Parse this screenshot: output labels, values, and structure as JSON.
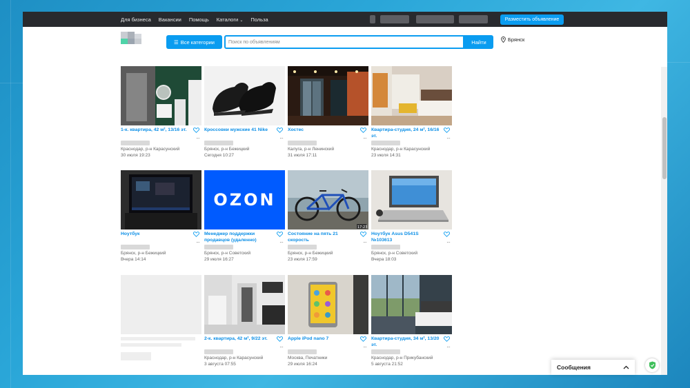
{
  "topbar": {
    "nav": [
      "Для бизнеса",
      "Вакансии",
      "Помощь",
      "Каталоги",
      "Польза"
    ],
    "post_button": "Разместить объявление"
  },
  "search": {
    "categories_button": "Все категории",
    "placeholder": "Поиск по объявлениям",
    "find_button": "Найти",
    "location": "Брянск"
  },
  "listings": [
    {
      "title": "1-к. квартира, 42 м², 13/16 эт.",
      "location": "Краснодар, р-н Карасунский",
      "date": "30 июля 19:23"
    },
    {
      "title": "Кроссовки мужские 41 Nike",
      "location": "Брянск, р-н Бежицкий",
      "date": "Сегодня 10:27"
    },
    {
      "title": "Хостес",
      "location": "Калуга, р-н Ленинский",
      "date": "31 июля 17:11"
    },
    {
      "title": "Квартира-студия, 24 м², 16/16 эт.",
      "location": "Краснодар, р-н Карасунский",
      "date": "23 июля 14:31"
    },
    {
      "title": "Ноутбук",
      "location": "Брянск, р-н Бежицкий",
      "date": "Вчера 14:14"
    },
    {
      "title": "Менеджер поддержки продавцов (удаленно)",
      "location": "Брянск, р-н Советский",
      "date": "29 июля 16:27"
    },
    {
      "title": "Состояние на пять 21 скорость",
      "location": "Брянск, р-н Бежицкий",
      "date": "23 июля 17:59"
    },
    {
      "title": "Ноутбук Asus D541S №103613",
      "location": "Брянск, р-н Советский",
      "date": "Вчера 18:03"
    },
    {
      "title": "2-к. квартира, 42 м², 9/22 эт.",
      "location": "Краснодар, р-н Карасунский",
      "date": "3 августа 07:55"
    },
    {
      "title": "Apple iPod nano 7",
      "location": "Москва, Печатники",
      "date": "29 июля 16:24"
    },
    {
      "title": "Квартира-студия, 34 м², 13/20 эт.",
      "location": "Краснодар, р-н Прикубанский",
      "date": "5 августа 21:52"
    }
  ],
  "thumb_labels": {
    "ozon": "OZON",
    "bike_tag": "17:23"
  },
  "messages": {
    "label": "Сообщения"
  },
  "colors": {
    "accent": "#0a9cf0",
    "topbar": "#282a2e",
    "link": "#0a8ee6"
  }
}
